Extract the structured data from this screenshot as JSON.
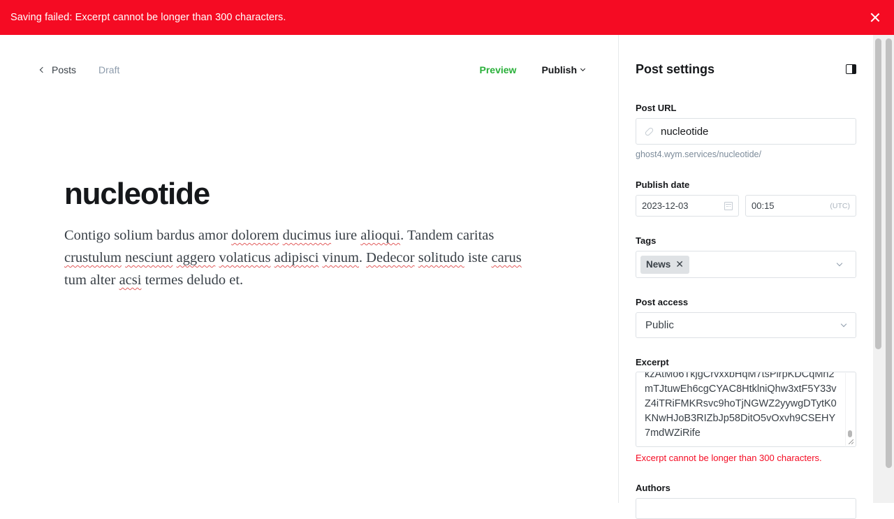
{
  "alert": {
    "message": "Saving failed: Excerpt cannot be longer than 300 characters."
  },
  "editor": {
    "back_label": "Posts",
    "status": "Draft",
    "preview_label": "Preview",
    "publish_label": "Publish",
    "title": "nucleotide",
    "body_segments": [
      {
        "t": "Contigo solium bardus amor ",
        "s": false
      },
      {
        "t": "dolorem",
        "s": true
      },
      {
        "t": " ",
        "s": false
      },
      {
        "t": "ducimus",
        "s": true
      },
      {
        "t": " iure ",
        "s": false
      },
      {
        "t": "alioqui",
        "s": true
      },
      {
        "t": ". Tandem caritas ",
        "s": false
      },
      {
        "t": "crustulum",
        "s": true
      },
      {
        "t": " ",
        "s": false
      },
      {
        "t": "nesciunt",
        "s": true
      },
      {
        "t": " ",
        "s": false
      },
      {
        "t": "aggero",
        "s": true
      },
      {
        "t": " ",
        "s": false
      },
      {
        "t": "volaticus",
        "s": true
      },
      {
        "t": " ",
        "s": false
      },
      {
        "t": "adipisci",
        "s": true
      },
      {
        "t": " ",
        "s": false
      },
      {
        "t": "vinum",
        "s": true
      },
      {
        "t": ". ",
        "s": false
      },
      {
        "t": "Dedecor",
        "s": true
      },
      {
        "t": " ",
        "s": false
      },
      {
        "t": "solitudo",
        "s": true
      },
      {
        "t": " iste ",
        "s": false
      },
      {
        "t": "carus",
        "s": true
      },
      {
        "t": " tum alter ",
        "s": false
      },
      {
        "t": "acsi",
        "s": true
      },
      {
        "t": " termes deludo et.",
        "s": false
      }
    ]
  },
  "settings": {
    "heading": "Post settings",
    "url_label": "Post URL",
    "url_value": "nucleotide",
    "url_hint": "ghost4.wym.services/nucleotide/",
    "date_label": "Publish date",
    "date_value": "2023-12-03",
    "time_value": "00:15",
    "timezone": "(UTC)",
    "tags_label": "Tags",
    "tags": [
      "News"
    ],
    "access_label": "Post access",
    "access_value": "Public",
    "excerpt_label": "Excerpt",
    "excerpt_value": "kzAtMo6TkjgCrvxxbHqM7tsPlrpKDCqMn2mTJtuwEh6cgCYAC8HtklniQhw3xtF5Y33vZ4iTRiFMKRsvc9hoTjNGWZ2yywgDTytK0KNwHJoB3RIZbJp58DitO5vOxvh9CSEHY7mdWZiRife",
    "excerpt_error": "Excerpt cannot be longer than 300 characters.",
    "authors_label": "Authors"
  },
  "colors": {
    "alert_bg": "#f50b23",
    "accent_green": "#2ab03a",
    "error_red": "#f50b23"
  }
}
